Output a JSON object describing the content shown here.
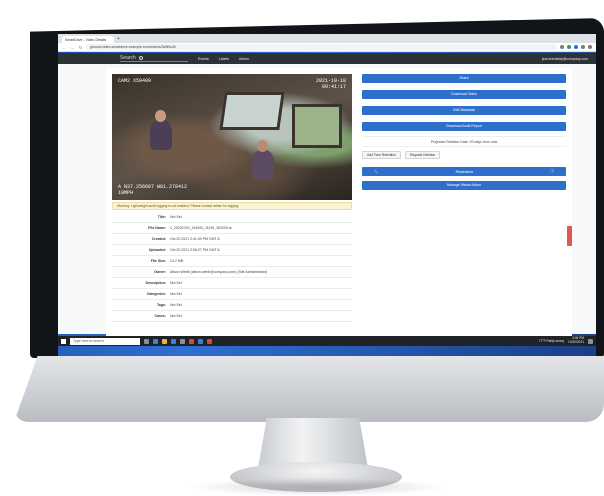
{
  "browser": {
    "tab_title": "SmartDrive - Video Details",
    "url": "ground-video.smartdrive.example.com/videos/3d9f0c2e",
    "new_tab": "+"
  },
  "appnav": {
    "search_placeholder": "Search",
    "links": [
      "Events",
      "Labels",
      "Admin"
    ],
    "user": "jean.tremblay@company.com"
  },
  "video": {
    "cam_label": "CAM2 X59409",
    "date": "2021-10-18",
    "time": "09:41:17",
    "gps_line1": "A N37.256687 W81.278412",
    "gps_line2": "18MPH"
  },
  "warning": {
    "text": "Warning: Lightweight audit logging is not enabled. Please contact admin for logging."
  },
  "details": [
    {
      "label": "Title:",
      "value": "Not Set"
    },
    {
      "label": "File Name:",
      "value": "1_20201019_194900_11199_300000.ts"
    },
    {
      "label": "Created:",
      "value": "Oct 20 2021 2:41:59 PM GMT-6"
    },
    {
      "label": "Uploaded:",
      "value": "Oct 20 2021 2:56:27 PM GMT-6"
    },
    {
      "label": "File Size:",
      "value": "14.2 MB"
    },
    {
      "label": "Owner:",
      "value": "Alison Webb (alison.webb@company.com) (Site Administrator)"
    },
    {
      "label": "Description:",
      "value": "Not Set"
    },
    {
      "label": "Categories:",
      "value": "Not Set"
    },
    {
      "label": "Tags:",
      "value": "Not Set"
    },
    {
      "label": "Cases:",
      "value": "Not Set"
    }
  ],
  "actions": {
    "share": "Share",
    "download": "Download Video",
    "edit_metadata": "Edit Metadata",
    "download_audit": "Download Audit Report",
    "retention": "Projected Deletion Date: 20 days from now",
    "add_retention": "Add Time Retention",
    "request_deletion": "Request Deletion",
    "redactions": "Redactions",
    "manage_status": "Manage Status Action"
  },
  "taskbar": {
    "search": "Type here to search",
    "weather": "77°F Partly sunny",
    "time": "3:06 PM",
    "date": "10/20/2021"
  },
  "colors": {
    "primary_button": "#2f6fcc",
    "navbar": "#2d3238",
    "warning_bg": "#fbf3d4"
  }
}
